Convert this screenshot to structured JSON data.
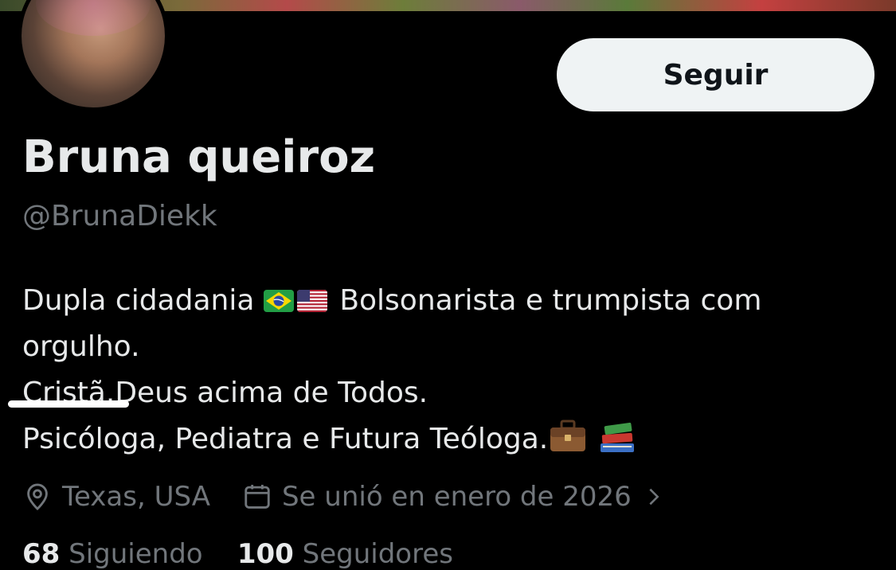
{
  "profile": {
    "follow_label": "Seguir",
    "display_name": "Bruna queiroz",
    "handle": "@BrunaDiekk",
    "bio": {
      "line1_a": "Dupla cidadania",
      "line1_b": "Bolsonarista e trumpista com",
      "line2": "orgulho.",
      "line3": "Cristã.Deus acima de Todos.",
      "line4": "Psicóloga, Pediatra e Futura Teóloga."
    },
    "location": "Texas, USA",
    "joined": "Se unió en enero de 2026",
    "stats": {
      "following_count": "68",
      "following_label": "Siguiendo",
      "followers_count": "100",
      "followers_label": "Seguidores"
    }
  },
  "icons": {
    "location": "location-pin-icon",
    "joined": "calendar-icon",
    "chevron": "chevron-right-icon",
    "flag_brazil": "brazil-flag-icon",
    "flag_usa": "usa-flag-icon",
    "briefcase": "briefcase-icon",
    "books": "books-icon"
  },
  "colors": {
    "background": "#000000",
    "primary_text": "#e7e9ea",
    "secondary_text": "#71767b",
    "button_bg": "#eff3f4",
    "button_text": "#0f1419"
  }
}
